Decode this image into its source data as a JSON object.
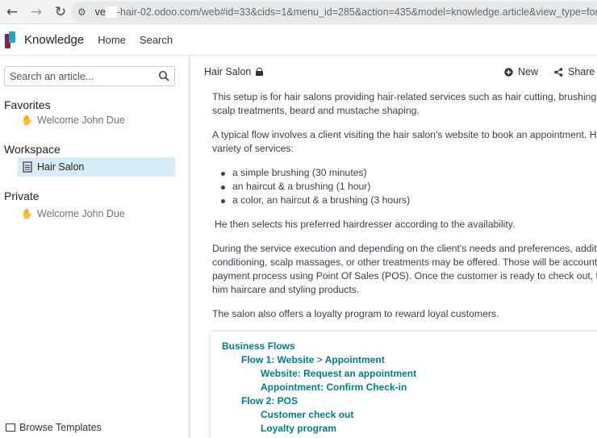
{
  "browser": {
    "url_prefix": "ve",
    "url_rest": "-hair-02.odoo.com/web#id=33&cids=1&menu_id=285&action=435&model=knowledge.article&view_type=form"
  },
  "app": {
    "title": "Knowledge",
    "menu": [
      "Home",
      "Search"
    ]
  },
  "sidebar": {
    "search_placeholder": "Search an article...",
    "favorites_title": "Favorites",
    "favorites": [
      {
        "icon": "waving-hand",
        "label": "Welcome John Due"
      }
    ],
    "workspace_title": "Workspace",
    "workspace": [
      {
        "icon": "page-icon",
        "label": "Hair Salon"
      }
    ],
    "private_title": "Private",
    "private": [
      {
        "icon": "waving-hand",
        "label": "Welcome John Due"
      }
    ],
    "browse_templates": "Browse Templates"
  },
  "article": {
    "title": "Hair Salon",
    "new_label": "New",
    "share_label": "Share",
    "p1_l1": "This setup is for hair salons providing hair-related services such as hair cutting, brushing, colorin",
    "p1_l2": "scalp treatments, beard and mustache shaping.",
    "p2_l1": "A typical flow involves a client visiting the hair salon's website to book an appointment. He sele",
    "p2_l2": "variety of services:",
    "bullets": [
      "a simple brushing (30 minutes)",
      "an haircut & a brushing (1 hour)",
      "a color, an haircut & a brushing (3 hours)"
    ],
    "p3": "He then selects his preferred hairdresser according to the availability.",
    "p4_l1": "During the service execution and depending on the client's needs and preferences, additional s",
    "p4_l2": "conditioning, scalp massages, or other treatments may be offered. Those will be accounted for",
    "p4_l3": "payment process using Point Of Sales (POS). Once the customer is ready to check out, the salon",
    "p4_l4": "him haircare and styling products.",
    "p5": "The salon also offers a loyalty program to reward loyal customers.",
    "flows": {
      "heading": "Business Flows",
      "flow1_a": "Flow 1: Website",
      "flow1_sep": ">",
      "flow1_b": "Appointment",
      "flow1_step1": "Website: Request an appointment",
      "flow1_step2": "Appointment: Confirm Check-in",
      "flow2": "Flow 2: POS",
      "flow2_step1": "Customer check out",
      "flow2_step2": "Loyalty program"
    }
  }
}
